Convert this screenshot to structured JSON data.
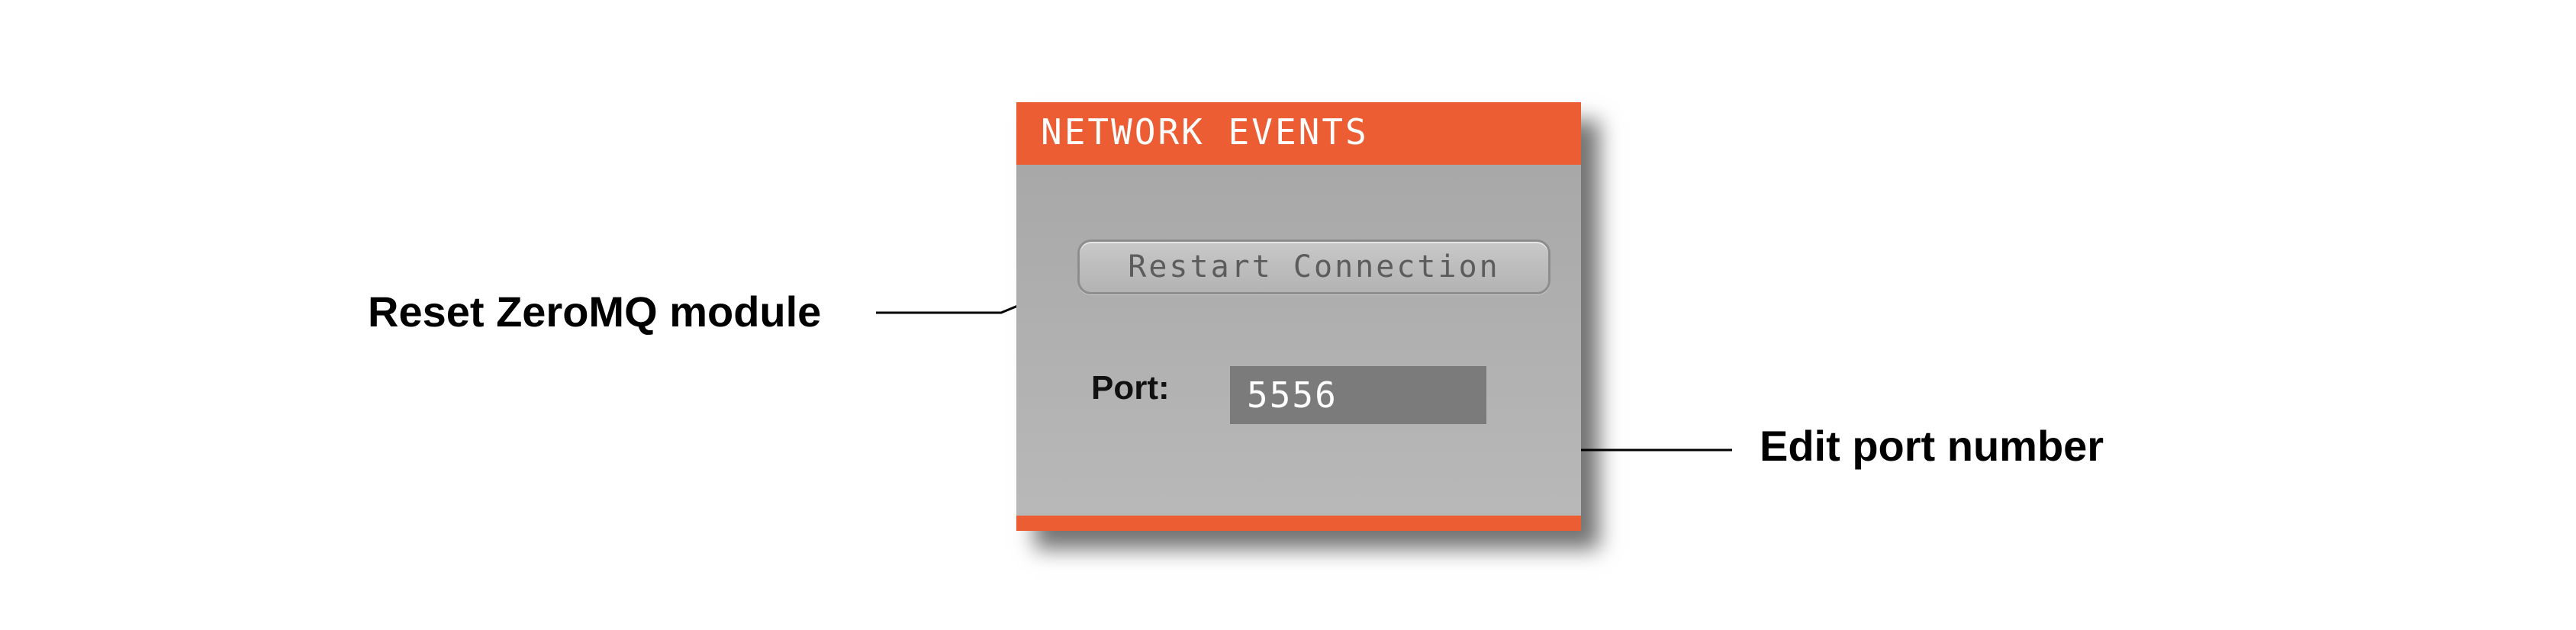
{
  "panel": {
    "title": "NETWORK EVENTS",
    "restart_button_label": "Restart Connection",
    "port_label": "Port:",
    "port_value": "5556"
  },
  "annotations": {
    "reset_callout": "Reset ZeroMQ module",
    "port_callout": "Edit port number"
  },
  "colors": {
    "accent": "#ec5d34",
    "panel_background": "#a9a9a9",
    "input_background": "#7b7b7b",
    "button_text": "#5c5c5c"
  }
}
